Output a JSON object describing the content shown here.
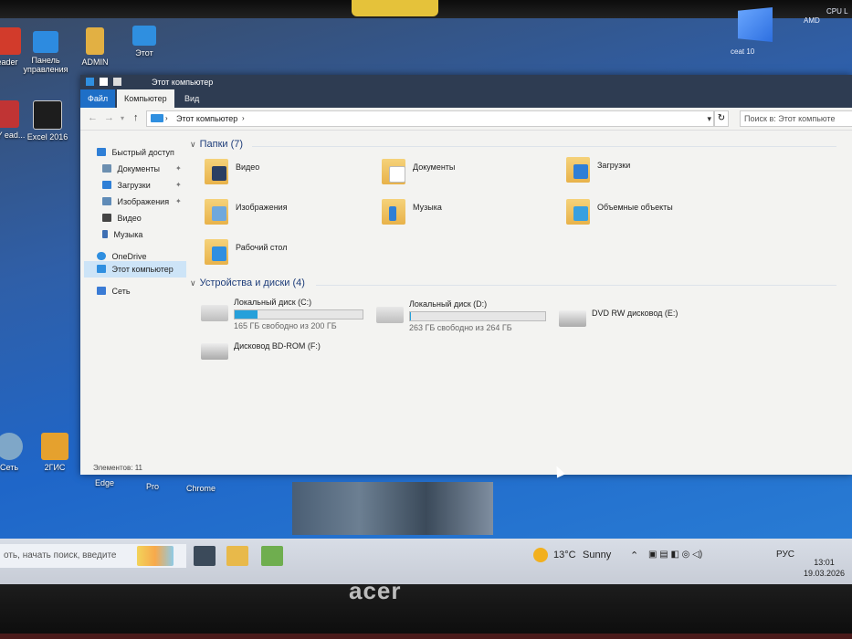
{
  "desktop": {
    "icons_top": [
      {
        "label": "eader"
      },
      {
        "label": "Панель управления"
      },
      {
        "label": "ADMIN"
      },
      {
        "label": "Этот"
      }
    ],
    "icons_second": [
      {
        "label": "SVY ead..."
      },
      {
        "label": "Excel 2016"
      }
    ],
    "icons_bottom": [
      {
        "label": "Сеть"
      },
      {
        "label": "2ГИС"
      }
    ],
    "taskbar_row_labels": [
      "Edge",
      "Pro",
      "Chrome"
    ],
    "corner_label_right": "CPU L",
    "corner_label_amd": "AMD",
    "win_label": "ceat 10"
  },
  "explorer": {
    "title": "Этот компьютер",
    "ribbon_tabs": [
      {
        "label": "Файл"
      },
      {
        "label": "Компьютер"
      },
      {
        "label": "Вид"
      }
    ],
    "address": "Этот компьютер",
    "search_placeholder": "Поиск в: Этот компьюте",
    "sidebar": {
      "quick_access": "Быстрый доступ",
      "items": [
        {
          "label": "Документы",
          "pinned": true,
          "color": "#6c8fb0"
        },
        {
          "label": "Загрузки",
          "pinned": true,
          "color": "#2f7fd6"
        },
        {
          "label": "Изображения",
          "pinned": true,
          "color": "#5f8bb7"
        },
        {
          "label": "Видео",
          "pinned": false,
          "color": "#444444"
        },
        {
          "label": "Музыка",
          "pinned": false,
          "color": "#3e6fb3"
        }
      ],
      "onedrive": "OneDrive",
      "this_pc": "Этот компьютер",
      "network": "Сеть"
    },
    "folders_header": "Папки (7)",
    "folders": [
      {
        "label": "Видео",
        "overlay": "#2b3f63"
      },
      {
        "label": "Документы",
        "overlay": "#ffffff"
      },
      {
        "label": "Загрузки",
        "overlay": "#2f7fd6"
      },
      {
        "label": "Изображения",
        "overlay": "#6fa8dc"
      },
      {
        "label": "Музыка",
        "overlay": "#2f7fd6"
      },
      {
        "label": "Объемные объекты",
        "overlay": "#38a0e0"
      },
      {
        "label": "Рабочий стол",
        "overlay": "#2f8fe0"
      }
    ],
    "drives_header": "Устройства и диски (4)",
    "drives": [
      {
        "label": "Локальный диск (C:)",
        "free": "165 ГБ свободно из 200 ГБ",
        "used_fraction": 0.175
      },
      {
        "label": "Локальный диск (D:)",
        "free": "263 ГБ свободно из 264 ГБ",
        "used_fraction": 0.004
      },
      {
        "label": "DVD RW дисковод (E:)"
      },
      {
        "label": "Дисковод BD-ROM (F:)"
      }
    ],
    "status": "Элементов: 11"
  },
  "taskbar": {
    "search_placeholder": "оть, начать поиск, введите",
    "weather_temp": "13°C",
    "weather_text": "Sunny",
    "language": "РУС",
    "time": "13:01",
    "date": "19.03.2026"
  },
  "brand": "acer"
}
